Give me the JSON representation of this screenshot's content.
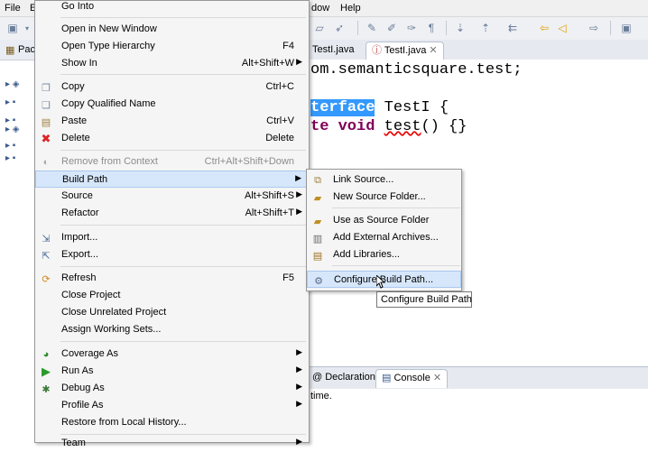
{
  "menubar": {
    "file": "File",
    "edit": "E",
    "window": "dow",
    "help": "Help"
  },
  "left_pane": {
    "tab_label": "Pac"
  },
  "editor": {
    "tabs": [
      {
        "label": "TestI.java"
      },
      {
        "label": "TestI.java"
      }
    ],
    "code": {
      "line1": "om.semanticsquare.test;",
      "line2_keyword": "terface",
      "line2_rest": " TestI {",
      "line3_kw1": "te",
      "line3_kw2": "void",
      "line3_name": "test",
      "line3_rest": "() {}"
    }
  },
  "bottom": {
    "tabs": [
      {
        "label": "Declaration"
      },
      {
        "label": "Console"
      }
    ],
    "text": "time."
  },
  "context_menu": {
    "items": [
      {
        "label": "Go Into",
        "shortcut": ""
      },
      {
        "label": "Open in New Window",
        "shortcut": ""
      },
      {
        "label": "Open Type Hierarchy",
        "shortcut": "F4"
      },
      {
        "label": "Show In",
        "shortcut": "Alt+Shift+W"
      },
      {
        "label": "Copy",
        "shortcut": "Ctrl+C"
      },
      {
        "label": "Copy Qualified Name",
        "shortcut": ""
      },
      {
        "label": "Paste",
        "shortcut": "Ctrl+V"
      },
      {
        "label": "Delete",
        "shortcut": "Delete"
      },
      {
        "label": "Remove from Context",
        "shortcut": "Ctrl+Alt+Shift+Down"
      },
      {
        "label": "Build Path",
        "shortcut": ""
      },
      {
        "label": "Source",
        "shortcut": "Alt+Shift+S"
      },
      {
        "label": "Refactor",
        "shortcut": "Alt+Shift+T"
      },
      {
        "label": "Import...",
        "shortcut": ""
      },
      {
        "label": "Export...",
        "shortcut": ""
      },
      {
        "label": "Refresh",
        "shortcut": "F5"
      },
      {
        "label": "Close Project",
        "shortcut": ""
      },
      {
        "label": "Close Unrelated Project",
        "shortcut": ""
      },
      {
        "label": "Assign Working Sets...",
        "shortcut": ""
      },
      {
        "label": "Coverage As",
        "shortcut": ""
      },
      {
        "label": "Run As",
        "shortcut": ""
      },
      {
        "label": "Debug As",
        "shortcut": ""
      },
      {
        "label": "Profile As",
        "shortcut": ""
      },
      {
        "label": "Restore from Local History...",
        "shortcut": ""
      },
      {
        "label": "Team",
        "shortcut": ""
      }
    ]
  },
  "build_path_submenu": {
    "items": [
      {
        "label": "Link Source..."
      },
      {
        "label": "New Source Folder..."
      },
      {
        "label": "Use as Source Folder"
      },
      {
        "label": "Add External Archives..."
      },
      {
        "label": "Add Libraries..."
      },
      {
        "label": "Configure Build Path..."
      }
    ]
  },
  "tooltip": {
    "text": "Configure Build Path"
  },
  "colors": {
    "highlight": "#d7e7fb",
    "selection": "#3399ff",
    "keyword": "#7f0055"
  }
}
